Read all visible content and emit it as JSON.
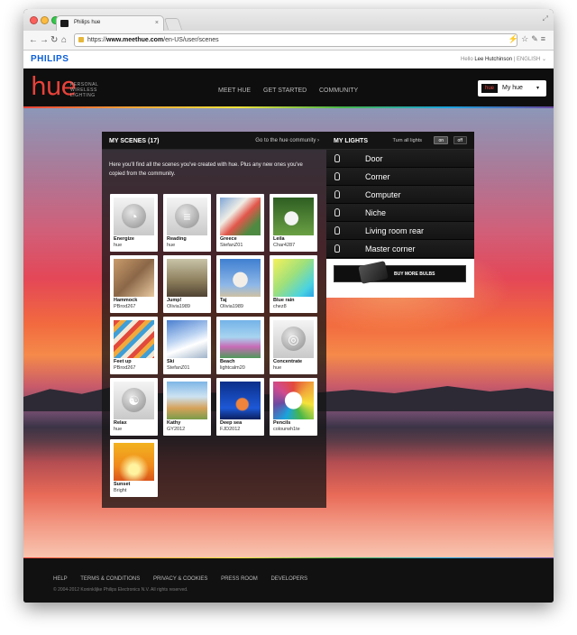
{
  "browser": {
    "tab_title": "Philips hue",
    "url_protocol": "https://",
    "url_domain": "www.meethue.com",
    "url_path": "/en-US/user/scenes"
  },
  "philips_bar": {
    "brand": "PHILIPS",
    "greeting": "Hello",
    "user": "Lee Hutchinson",
    "separator": "|",
    "language": "ENGLISH"
  },
  "header": {
    "logo": "hue",
    "tagline": [
      "PERSONAL",
      "WIRELESS",
      "LIGHTING"
    ],
    "nav": [
      "MEET HUE",
      "GET STARTED",
      "COMMUNITY"
    ],
    "my_hue_label": "My hue",
    "my_hue_badge": "hue"
  },
  "scenes": {
    "title": "MY SCENES (17)",
    "community_link": "Go to the hue community  ›",
    "intro": "Here you'll find all the scenes you've created with hue. Plus any new ones you've copied from the community.",
    "items": [
      {
        "name": "Energize",
        "author": "hue"
      },
      {
        "name": "Reading",
        "author": "hue"
      },
      {
        "name": "Greece",
        "author": "StefanZ01"
      },
      {
        "name": "Leila",
        "author": "Char4287"
      },
      {
        "name": "Hammock",
        "author": "PBrod267"
      },
      {
        "name": "Jump!",
        "author": "Olivia1989"
      },
      {
        "name": "Taj",
        "author": "Olivia1989"
      },
      {
        "name": "Blue rain",
        "author": "chez8"
      },
      {
        "name": "Feet up",
        "author": "PBrod267"
      },
      {
        "name": "Ski",
        "author": "StefanZ01"
      },
      {
        "name": "Beach",
        "author": "lightcalm20"
      },
      {
        "name": "Concentrate",
        "author": "hue"
      },
      {
        "name": "Relax",
        "author": "hue"
      },
      {
        "name": "Kathy",
        "author": "GY2012"
      },
      {
        "name": "Deep sea",
        "author": "FJD2012"
      },
      {
        "name": "Pencils",
        "author": "colourwh1te"
      },
      {
        "name": "Sunset",
        "author": "Bright"
      }
    ]
  },
  "lights": {
    "title": "MY LIGHTS",
    "turn_all": "Turn all lights",
    "on_label": "on",
    "off_label": "off",
    "items": [
      "Door",
      "Corner",
      "Computer",
      "Niche",
      "Living room rear",
      "Master corner"
    ],
    "buy_label": "BUY MORE BULBS"
  },
  "footer": {
    "links": [
      "HELP",
      "TERMS & CONDITIONS",
      "PRIVACY & COOKIES",
      "PRESS ROOM",
      "DEVELOPERS"
    ],
    "copyright": "© 2004-2012 Koninklijke Philips Electronics N.V. All rights reserved."
  },
  "colors": {
    "hue_red": "#e8423a",
    "philips_blue": "#0b5ed7",
    "panel_dark": "#141414"
  }
}
